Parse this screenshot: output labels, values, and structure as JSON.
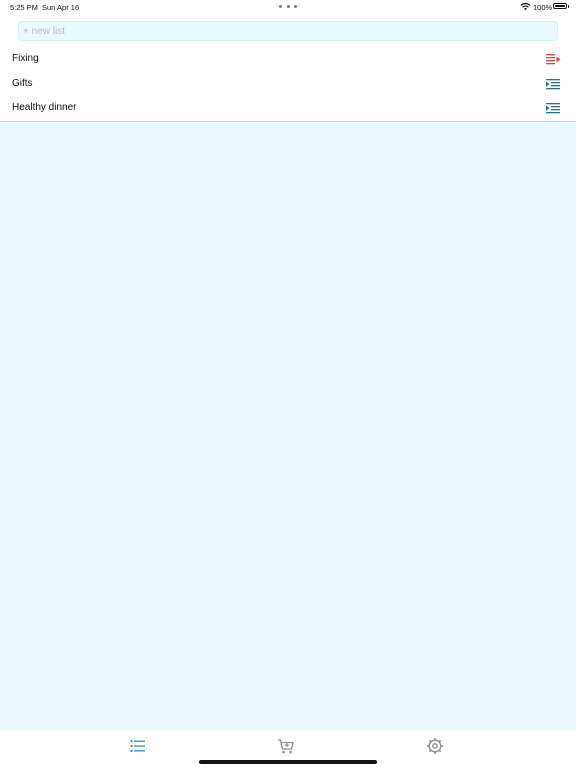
{
  "status_bar": {
    "time": "5:25 PM",
    "date": "Sun Apr 16",
    "battery": "100%",
    "wifi_icon": "wifi-icon",
    "battery_icon": "battery-icon"
  },
  "new_list": {
    "placeholder": "+ new list",
    "value": ""
  },
  "lists": [
    {
      "name": "Fixing",
      "icon": "list-delete-icon",
      "icon_color": "#e0463b"
    },
    {
      "name": "Gifts",
      "icon": "list-indent-icon",
      "icon_color": "#2c6f95"
    },
    {
      "name": "Healthy dinner",
      "icon": "list-indent-icon",
      "icon_color": "#2c6f95"
    }
  ],
  "tab_bar": {
    "tabs": [
      {
        "icon": "list-icon",
        "selected": true
      },
      {
        "icon": "cart-icon",
        "selected": false
      },
      {
        "icon": "settings-icon",
        "selected": false
      }
    ]
  },
  "colors": {
    "background": "#e9f9fd",
    "accent": "#2f86d6",
    "fixing_icon": "#e0463b",
    "list_icon": "#2c6f95",
    "inactive_tab": "#8e8e93"
  }
}
